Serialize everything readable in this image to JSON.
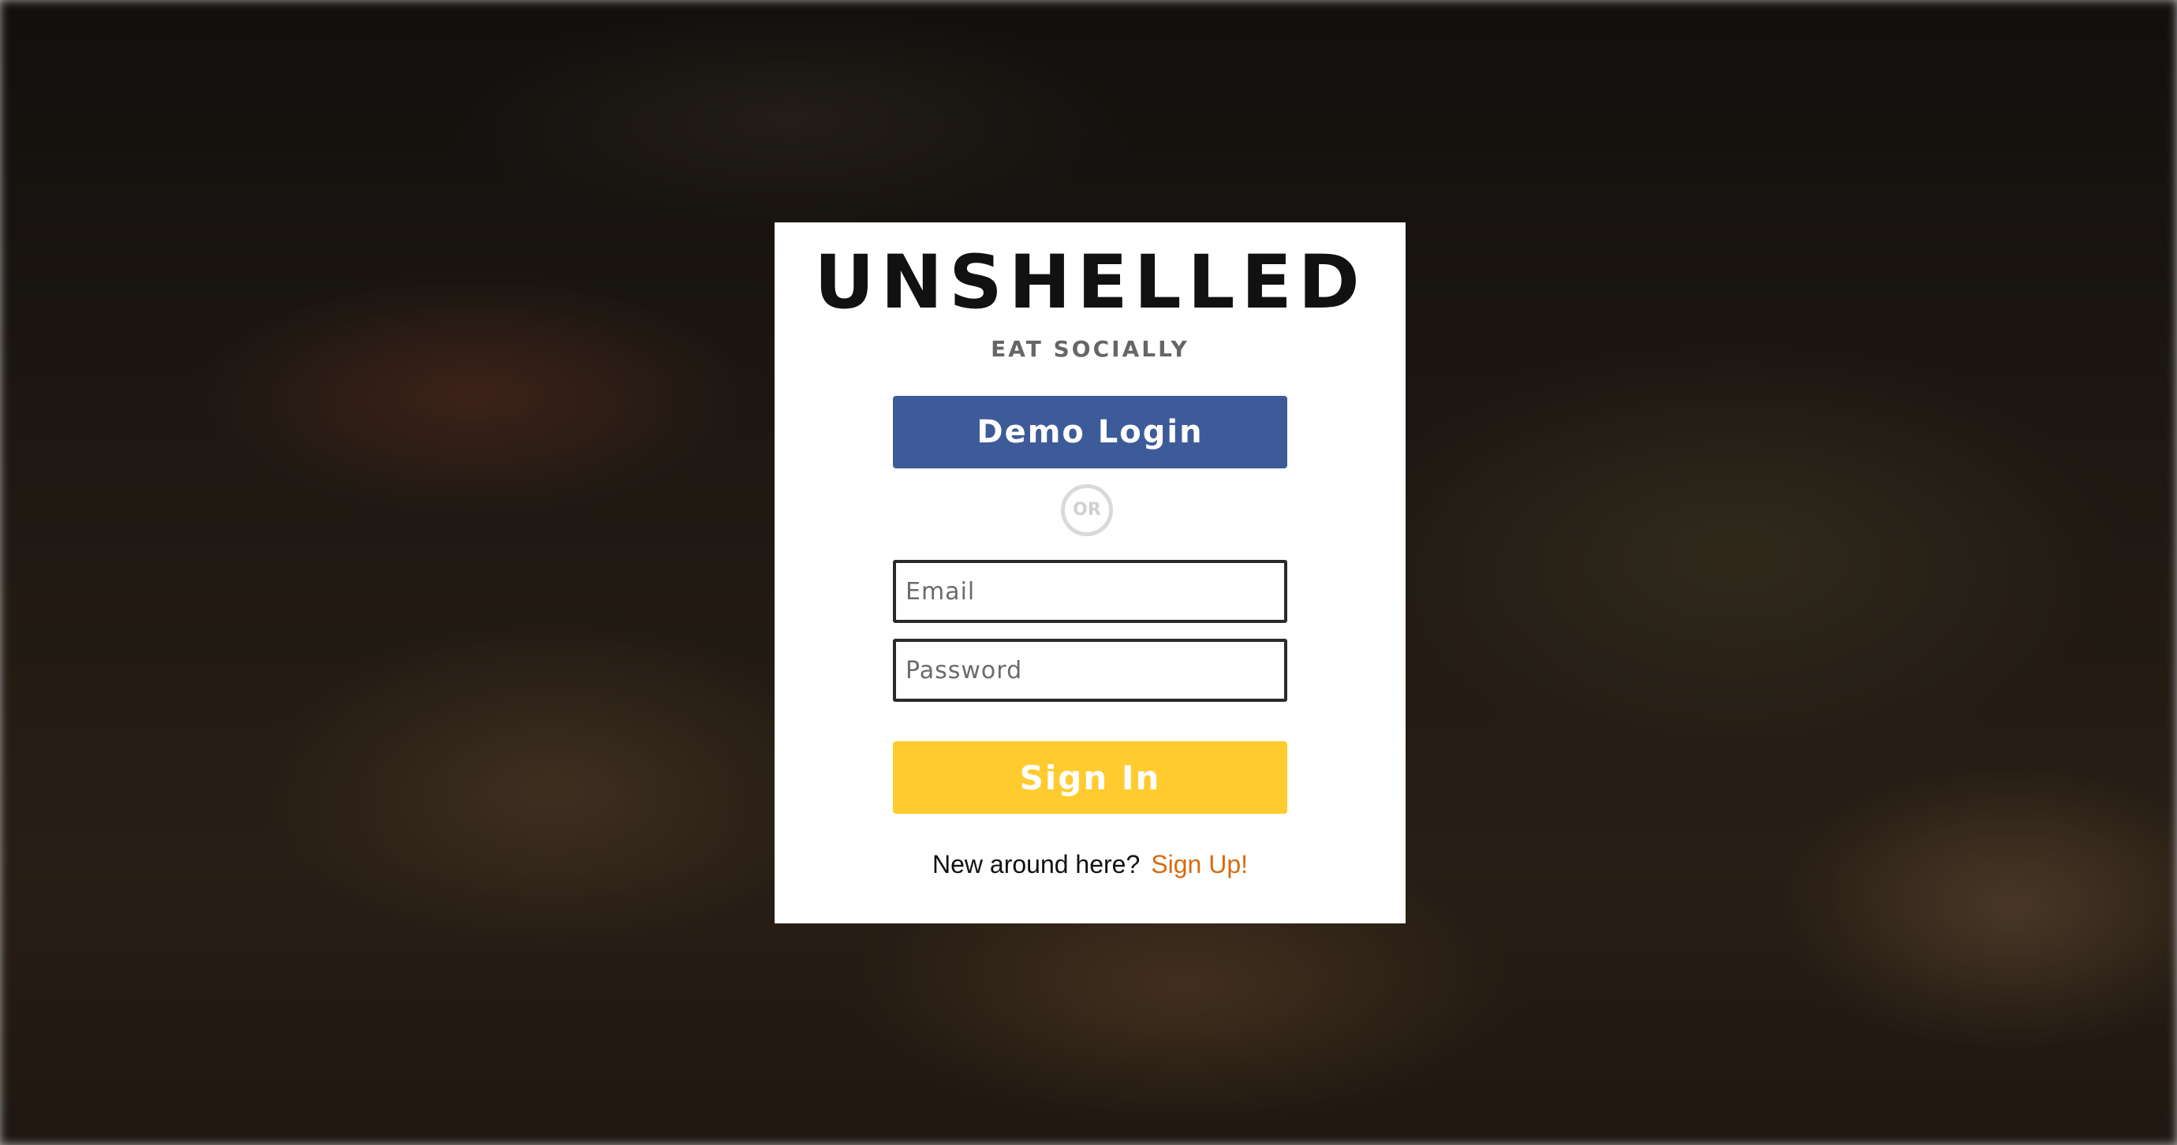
{
  "brand": {
    "title": "UNSHELLED",
    "tagline": "EAT SOCIALLY"
  },
  "login": {
    "demo_label": "Demo Login",
    "divider_label": "OR",
    "email_placeholder": "Email",
    "email_value": "",
    "password_placeholder": "Password",
    "password_value": "",
    "signin_label": "Sign In",
    "signup_prompt": "New around here?",
    "signup_link": "Sign Up!"
  },
  "colors": {
    "demo_button": "#3e5b99",
    "signin_button": "#ffcb2f",
    "signup_link": "#d86a10"
  }
}
